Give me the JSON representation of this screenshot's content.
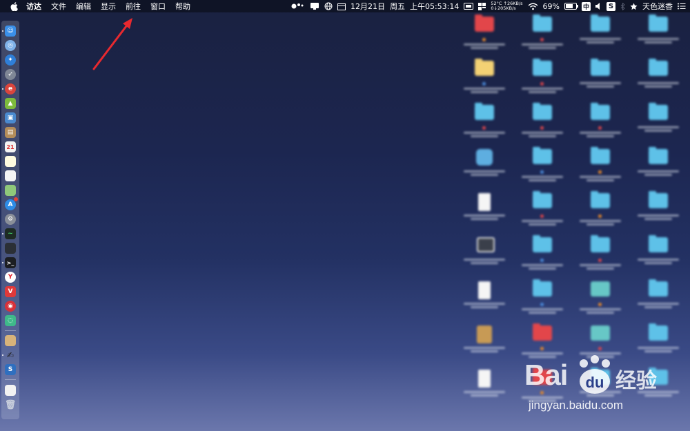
{
  "menubar": {
    "app_name": "访达",
    "menus": [
      "文件",
      "编辑",
      "显示",
      "前往",
      "窗口",
      "帮助"
    ],
    "status": {
      "temperature": "52°C",
      "upload_speed": "↑26KB/s",
      "download_speed": "0↓205KB/s",
      "date": "12月21日",
      "weekday": "周五",
      "time": "上午05:53:14",
      "battery": "69%",
      "battery_level": 0.69,
      "input_method": "中",
      "sogou": "S",
      "user_name": "天色迷香"
    }
  },
  "dock": {
    "calendar_day": "21"
  },
  "desktop": {
    "items": [
      {
        "icon": "red",
        "label": "",
        "dot": "#e88a2a"
      },
      {
        "icon": "folder",
        "label": "",
        "dot": "#e2464a"
      },
      {
        "icon": "folder",
        "label": "",
        "dot": ""
      },
      {
        "icon": "folder",
        "label": "",
        "dot": ""
      },
      {
        "icon": "yellow",
        "label": "",
        "dot": "#4d8fe0"
      },
      {
        "icon": "folder",
        "label": "",
        "dot": "#e2464a"
      },
      {
        "icon": "folder",
        "label": "",
        "dot": ""
      },
      {
        "icon": "folder",
        "label": "",
        "dot": ""
      },
      {
        "icon": "folder",
        "label": "",
        "dot": "#e2464a"
      },
      {
        "icon": "folder",
        "label": "",
        "dot": "#e2464a"
      },
      {
        "icon": "folder",
        "label": "",
        "dot": "#e2464a"
      },
      {
        "icon": "folder",
        "label": "",
        "dot": ""
      },
      {
        "icon": "app",
        "label": "",
        "dot": ""
      },
      {
        "icon": "folder",
        "label": "",
        "dot": "#4d8fe0"
      },
      {
        "icon": "folder",
        "label": "",
        "dot": "#e88a2a"
      },
      {
        "icon": "folder",
        "label": "",
        "dot": ""
      },
      {
        "icon": "doc",
        "label": "",
        "dot": ""
      },
      {
        "icon": "folder",
        "label": "",
        "dot": "#e2464a"
      },
      {
        "icon": "folder",
        "label": "",
        "dot": "#e88a2a"
      },
      {
        "icon": "folder",
        "label": "",
        "dot": ""
      },
      {
        "icon": "dark",
        "label": "",
        "dot": ""
      },
      {
        "icon": "folder",
        "label": "",
        "dot": "#4d8fe0"
      },
      {
        "icon": "folder",
        "label": "",
        "dot": "#e2464a"
      },
      {
        "icon": "folder",
        "label": "",
        "dot": ""
      },
      {
        "icon": "doc",
        "label": "",
        "dot": ""
      },
      {
        "icon": "folder",
        "label": "",
        "dot": "#4d8fe0"
      },
      {
        "icon": "teal",
        "label": "",
        "dot": "#e88a2a"
      },
      {
        "icon": "folder",
        "label": "",
        "dot": ""
      },
      {
        "icon": "tan",
        "label": "",
        "dot": ""
      },
      {
        "icon": "red",
        "label": "",
        "dot": "#e88a2a"
      },
      {
        "icon": "teal",
        "label": "",
        "dot": "#e2464a"
      },
      {
        "icon": "folder",
        "label": "",
        "dot": ""
      },
      {
        "icon": "doc",
        "label": "",
        "dot": ""
      },
      {
        "icon": "red",
        "label": "",
        "dot": "#e88a2a"
      },
      {
        "icon": "folder",
        "label": "",
        "dot": ""
      },
      {
        "icon": "folder",
        "label": "",
        "dot": ""
      }
    ]
  },
  "watermark": {
    "brand": "Bai",
    "brand_du": "du",
    "brand_cn": "经验",
    "url": "jingyan.baidu.com"
  },
  "colors": {
    "menubar_bg": "#0f1426",
    "annotation_arrow": "#e8292f",
    "folder_blue": "#5ec1e8"
  }
}
